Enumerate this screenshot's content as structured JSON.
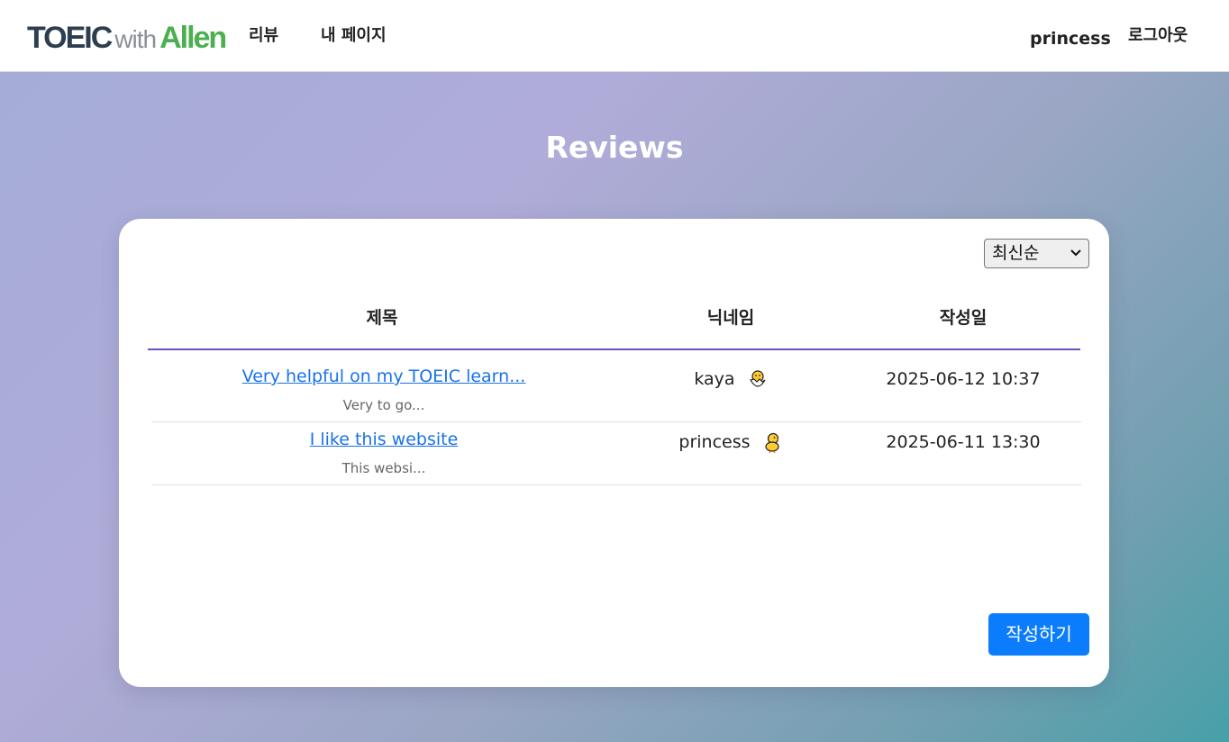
{
  "nav": {
    "logo_part1": "TOEIC",
    "logo_part2": "with",
    "logo_part3": "Allen",
    "review_label": "리뷰",
    "mypage_label": "내 페이지",
    "username": "princess",
    "logout_label": "로그아웃"
  },
  "colors": {
    "logo_dark": "#2c3e50",
    "logo_green": "#4caf50",
    "link_blue": "#1a73e8",
    "button_blue": "#0b7dfc",
    "header_line": "#6c4fc4"
  },
  "page": {
    "title": "Reviews"
  },
  "sort": {
    "selected": "최신순"
  },
  "table": {
    "headers": [
      "제목",
      "닉네임",
      "작성일"
    ],
    "rows": [
      {
        "title": "Very helpful on my TOEIC learn...",
        "preview": "Very to go...",
        "nickname": "kaya",
        "badge_icon": "hatching-chick-icon",
        "date": "2025-06-12 10:37"
      },
      {
        "title": "I like this website",
        "preview": "This websi...",
        "nickname": "princess",
        "badge_icon": "chick-icon",
        "date": "2025-06-11 13:30"
      }
    ]
  },
  "actions": {
    "write_label": "작성하기"
  }
}
